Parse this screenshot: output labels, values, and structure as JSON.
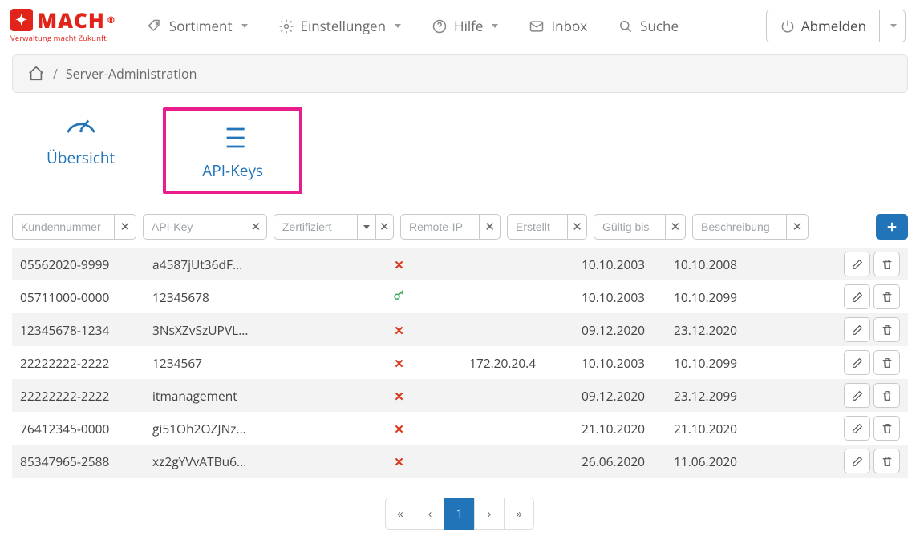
{
  "brand": {
    "name": "MACH",
    "tagline": "Verwaltung macht Zukunft",
    "reg": "®"
  },
  "nav": {
    "sortiment": "Sortiment",
    "einstellungen": "Einstellungen",
    "hilfe": "Hilfe",
    "inbox": "Inbox",
    "suche": "Suche"
  },
  "logout": {
    "label": "Abmelden"
  },
  "breadcrumb": {
    "current": "Server-Administration"
  },
  "tabs": {
    "overview": "Übersicht",
    "apikeys": "API-Keys"
  },
  "filters": {
    "kundennummer": "Kundennummer",
    "apikey": "API-Key",
    "zertifiziert": "Zertifiziert",
    "remoteip": "Remote-IP",
    "erstellt": "Erstellt",
    "gueltig": "Gültig bis",
    "beschreibung": "Beschreibung"
  },
  "rows": [
    {
      "kunde": "05562020-9999",
      "api": "a4587jUt36dF...",
      "cert": "x",
      "remote": "",
      "erst": "10.10.2003",
      "gult": "10.10.2008"
    },
    {
      "kunde": "05711000-0000",
      "api": "12345678",
      "cert": "key",
      "remote": "",
      "erst": "10.10.2003",
      "gult": "10.10.2099"
    },
    {
      "kunde": "12345678-1234",
      "api": "3NsXZvSzUPVL...",
      "cert": "x",
      "remote": "",
      "erst": "09.12.2020",
      "gult": "23.12.2020"
    },
    {
      "kunde": "22222222-2222",
      "api": "1234567",
      "cert": "x",
      "remote": "172.20.20.4",
      "erst": "10.10.2003",
      "gult": "10.10.2099"
    },
    {
      "kunde": "22222222-2222",
      "api": "itmanagement",
      "cert": "x",
      "remote": "",
      "erst": "09.12.2020",
      "gult": "23.12.2099"
    },
    {
      "kunde": "76412345-0000",
      "api": "gi51Oh2OZJNz...",
      "cert": "x",
      "remote": "",
      "erst": "21.10.2020",
      "gult": "21.10.2020"
    },
    {
      "kunde": "85347965-2588",
      "api": "xz2gYVvATBu6...",
      "cert": "x",
      "remote": "",
      "erst": "26.06.2020",
      "gult": "11.06.2020"
    }
  ],
  "pager": {
    "first": "«",
    "prev": "‹",
    "current": "1",
    "next": "›",
    "last": "»"
  }
}
